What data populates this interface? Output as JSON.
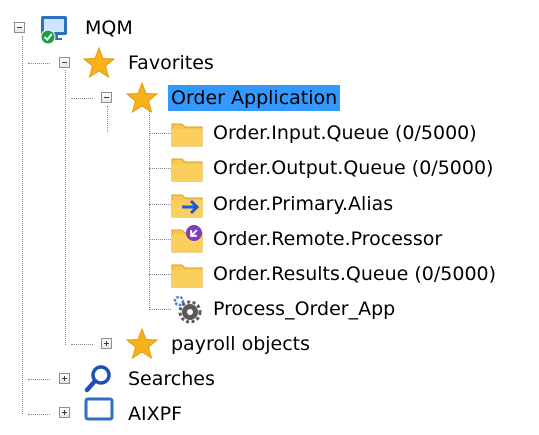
{
  "tree": {
    "root": {
      "label": "MQM",
      "icon": "queue-manager-connected-icon"
    },
    "favorites": {
      "label": "Favorites",
      "icon": "star-icon",
      "children": [
        {
          "label": "Order Application",
          "icon": "star-icon",
          "selected": true,
          "children": [
            {
              "label": "Order.Input.Queue (0/5000)",
              "icon": "local-queue-folder-icon"
            },
            {
              "label": "Order.Output.Queue (0/5000)",
              "icon": "local-queue-folder-icon"
            },
            {
              "label": "Order.Primary.Alias",
              "icon": "alias-queue-icon"
            },
            {
              "label": "Order.Remote.Processor",
              "icon": "remote-queue-icon"
            },
            {
              "label": "Order.Results.Queue (0/5000)",
              "icon": "local-queue-folder-icon"
            },
            {
              "label": "Process_Order_App",
              "icon": "process-gears-icon"
            }
          ]
        },
        {
          "label": "payroll objects",
          "icon": "star-icon"
        }
      ]
    },
    "searches": {
      "label": "Searches",
      "icon": "magnifier-icon"
    },
    "partial_next": {
      "label": "AIXPF",
      "icon": "queue-manager-icon"
    }
  },
  "colors": {
    "selection": "#3399ff",
    "star": "#f7b21b",
    "folder": "#f9c74f",
    "connector": "#8a8a8a"
  }
}
